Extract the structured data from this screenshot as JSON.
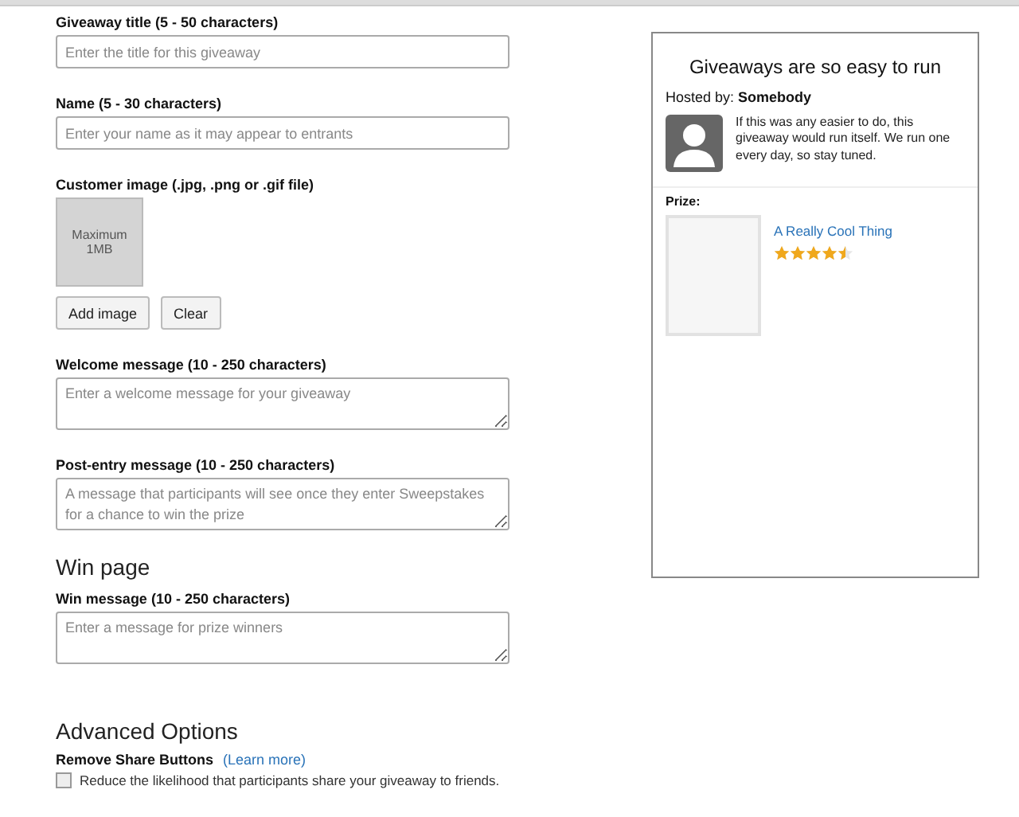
{
  "form": {
    "fields": [
      {
        "kind": "input",
        "label": "Giveaway title (5 - 50 characters)",
        "placeholder": "Enter the title for this giveaway"
      },
      {
        "kind": "input",
        "label": "Name (5 - 30 characters)",
        "placeholder": "Enter your name as it may appear to entrants"
      },
      {
        "kind": "image",
        "label": "Customer image (.jpg, .png or .gif file)",
        "hint": "Maximum 1MB",
        "buttons": [
          "Add image",
          "Clear"
        ]
      },
      {
        "kind": "textarea",
        "label": "Welcome message (10 - 250 characters)",
        "placeholder": "Enter a welcome message for your giveaway"
      },
      {
        "kind": "textarea",
        "label": "Post-entry message (10 - 250 characters)",
        "placeholder": "A message that participants will see once they enter Sweepstakes for a chance to win the prize"
      }
    ]
  },
  "win_page": {
    "heading": "Win page",
    "label": "Win message (10 - 250 characters)",
    "placeholder": "Enter a message for prize winners"
  },
  "advanced": {
    "heading": "Advanced Options",
    "label": "Remove Share Buttons",
    "link": "(Learn more)",
    "checkbox": {
      "label": "Reduce the likelihood that participants share your giveaway to friends.",
      "checked": false
    }
  },
  "preview": {
    "title": "Giveaways are so easy to run",
    "hosted_by": "Hosted by: **Somebody**",
    "description": "If this was any easier to do, this giveaway would run itself. We run one every day, so stay tuned.",
    "prize_label": "Prize:",
    "prize_name": "A Really Cool Thing",
    "stars": 4.5
  }
}
